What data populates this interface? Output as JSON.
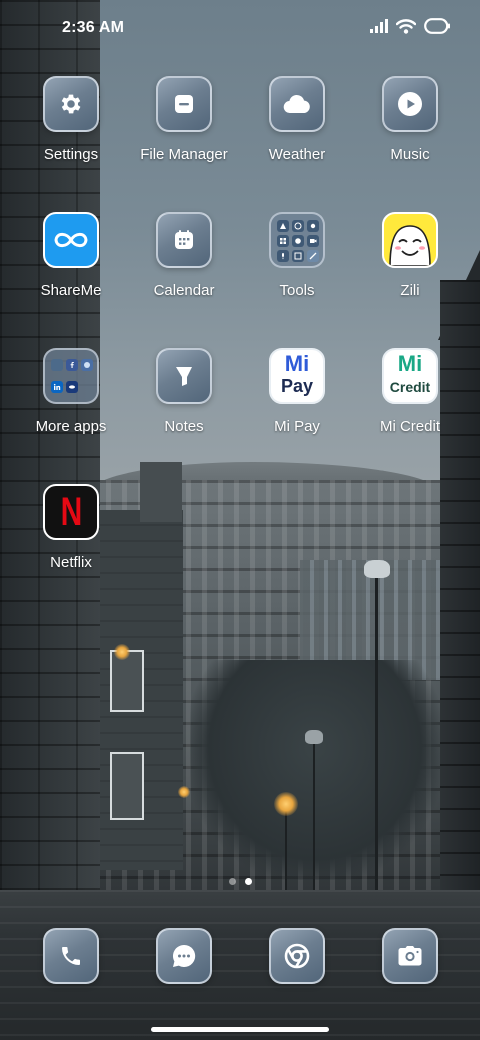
{
  "status_bar": {
    "time": "2:36 AM",
    "icons": [
      "signal-icon",
      "wifi-icon",
      "battery-icon"
    ]
  },
  "apps": [
    {
      "id": "settings",
      "label": "Settings",
      "icon": "gear-icon",
      "style": "glass"
    },
    {
      "id": "file-manager",
      "label": "File Manager",
      "icon": "folder-icon",
      "style": "glass"
    },
    {
      "id": "weather",
      "label": "Weather",
      "icon": "cloud-icon",
      "style": "glass"
    },
    {
      "id": "music",
      "label": "Music",
      "icon": "play-icon",
      "style": "glass"
    },
    {
      "id": "shareme",
      "label": "ShareMe",
      "icon": "infinity-icon",
      "style": "brand",
      "color": "#1e9bf0"
    },
    {
      "id": "calendar",
      "label": "Calendar",
      "icon": "calendar-icon",
      "style": "glass"
    },
    {
      "id": "tools",
      "label": "Tools",
      "icon": "tools-folder-icon",
      "style": "folder"
    },
    {
      "id": "zili",
      "label": "Zili",
      "icon": "zili-face-icon",
      "style": "brand",
      "color": "#ffe93c"
    },
    {
      "id": "more-apps",
      "label": "More apps",
      "icon": "more-apps-folder-icon",
      "style": "folder"
    },
    {
      "id": "notes",
      "label": "Notes",
      "icon": "notes-icon",
      "style": "glass"
    },
    {
      "id": "mi-pay",
      "label": "Mi Pay",
      "icon": "mi-pay-logo",
      "style": "brand",
      "logo_line1": "Mi",
      "logo_line2": "Pay",
      "color": "#ffffff"
    },
    {
      "id": "mi-credit",
      "label": "Mi Credit",
      "icon": "mi-credit-logo",
      "style": "brand",
      "logo_line1": "Mi",
      "logo_line2": "Credit",
      "color": "#ffffff"
    },
    {
      "id": "netflix",
      "label": "Netflix",
      "icon": "netflix-logo",
      "style": "brand",
      "logo": "N",
      "color": "#e50914"
    }
  ],
  "page_indicator": {
    "pages": 2,
    "active": 2
  },
  "dock": [
    {
      "id": "phone",
      "icon": "phone-icon"
    },
    {
      "id": "messages",
      "icon": "message-icon"
    },
    {
      "id": "chrome",
      "icon": "chrome-icon"
    },
    {
      "id": "camera",
      "icon": "camera-icon"
    }
  ],
  "colors": {
    "glass_top": "#93a3b3",
    "glass_bottom": "#52667a",
    "mi_green": "#1aa886",
    "mi_blue": "#2f5bd8",
    "netflix_red": "#e50914"
  }
}
